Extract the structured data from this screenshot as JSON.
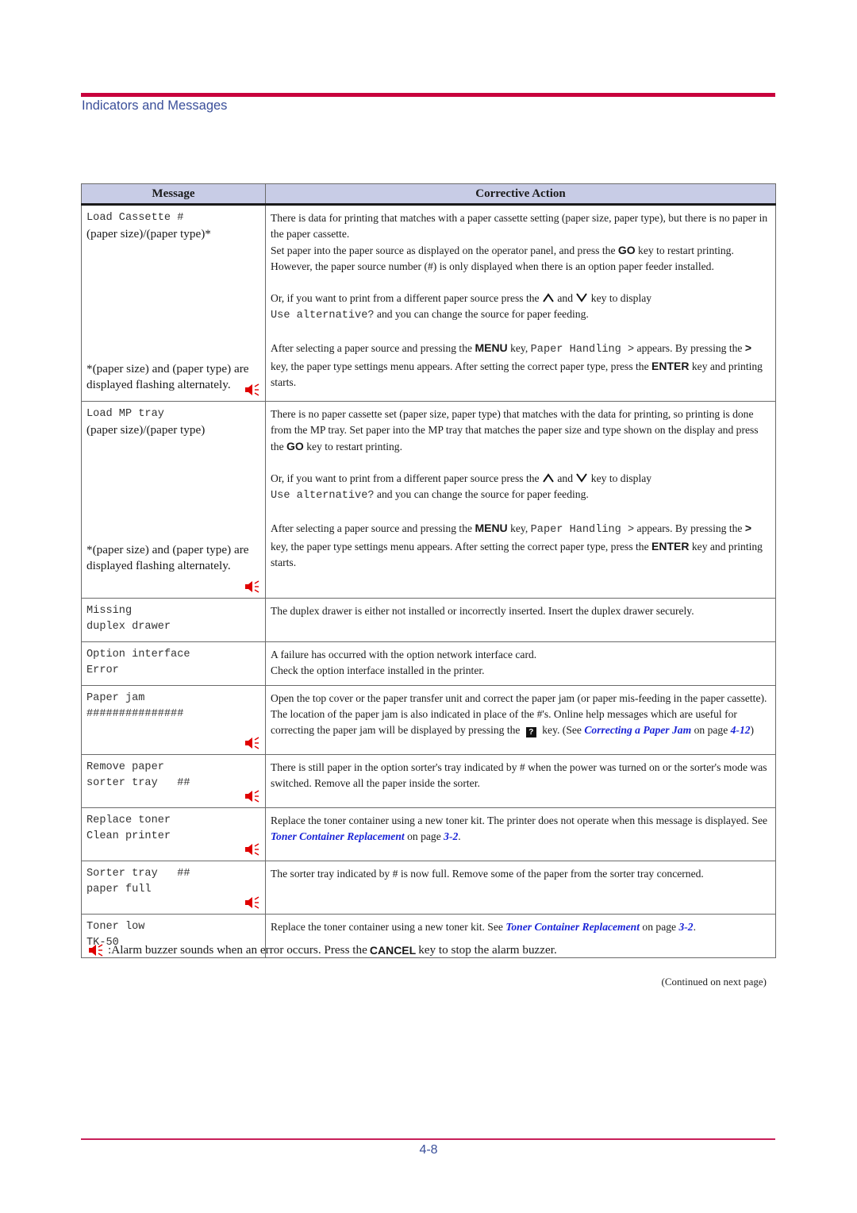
{
  "header": {
    "section_title": "Indicators and Messages"
  },
  "table": {
    "columns": [
      "Message",
      "Corrective Action"
    ],
    "rows": [
      {
        "message_lines": [
          "Load Cassette #"
        ],
        "message_serif": "(paper size)/(paper type)*",
        "note": "*(paper size) and (paper type) are displayed flashing alternately.",
        "alarm": true,
        "p1": "There is data for printing that matches with a paper cassette setting (paper size, paper type), but there is no paper in the paper cassette.",
        "p2_pre": "Set paper into the paper source as displayed on the operator panel, and press the ",
        "p2_key": "GO",
        "p2_post": " key to restart printing. However, the paper source number (#) is only displayed when there is an option paper feeder installed.",
        "p3_pre": "Or, if you want to print from a different paper source press the ",
        "p3_and": " and ",
        "p3_post": " key to display ",
        "p3_mono": "Use alternative?",
        "p3_end": " and you can change the source for paper feeding.",
        "p4_pre": "After selecting a paper source and pressing the ",
        "p4_key1": "MENU",
        "p4_mid": " key, ",
        "p4_mono": "Paper Handling >",
        "p4_mid2": " appears. By pressing the ",
        "p4_key2": ">",
        "p4_mid3": " key, the paper type settings menu appears. After setting the correct paper type, press the ",
        "p4_key3": "ENTER",
        "p4_end": " key and printing starts."
      },
      {
        "message_lines": [
          "Load MP tray"
        ],
        "message_serif": "(paper size)/(paper type)",
        "note": "*(paper size) and (paper type) are displayed flashing alternately.",
        "alarm": true,
        "p1_pre": "There is no paper cassette set (paper size, paper type) that matches with the data for printing, so printing is done from the MP tray. Set paper into the MP tray that matches the paper size and type shown on the display and press the ",
        "p1_key": "GO",
        "p1_post": " key to restart printing.",
        "p3_pre": "Or, if you want to print from a different paper source press the ",
        "p3_and": " and ",
        "p3_post": " key to display ",
        "p3_mono": "Use alternative?",
        "p3_end": " and you can change the source for paper feeding.",
        "p4_pre": "After selecting a paper source and pressing the ",
        "p4_key1": "MENU",
        "p4_mid": " key, ",
        "p4_mono": "Paper Handling >",
        "p4_mid2": " appears. By pressing the ",
        "p4_key2": ">",
        "p4_mid3": " key, the paper type settings menu appears. After setting the correct paper type, press the ",
        "p4_key3": "ENTER",
        "p4_end": " key and printing starts."
      },
      {
        "message_lines": [
          "Missing",
          "duplex drawer"
        ],
        "alarm": false,
        "action": "The duplex drawer is either not installed or incorrectly inserted. Insert the duplex drawer securely."
      },
      {
        "message_lines": [
          "Option interface",
          "Error"
        ],
        "alarm": false,
        "action_l1": "A failure has occurred with the option network interface card.",
        "action_l2": "Check the option interface installed in the printer."
      },
      {
        "message_lines": [
          "Paper jam",
          "###############"
        ],
        "alarm": true,
        "action_pre": "Open the top cover or the paper transfer unit and correct the paper jam (or paper mis-feeding in the paper cassette). The location of the paper jam is also indicated in place of the #'s. Online help messages which are useful for correcting the paper jam will be displayed by pressing the ",
        "help_key": "?",
        "action_mid": " key. (See ",
        "link": "Correcting a Paper Jam",
        "action_mid2": " on page ",
        "page_ref": "4-12",
        "action_end": ")"
      },
      {
        "message_lines": [
          "Remove paper",
          "sorter tray   ##"
        ],
        "alarm": true,
        "action": "There is still paper in the option sorter's tray indicated by # when the power was turned on or the sorter's mode was switched. Remove all the paper inside the sorter."
      },
      {
        "message_lines": [
          "Replace toner",
          "Clean printer"
        ],
        "alarm": true,
        "action_pre": "Replace the toner container using a new toner kit. The printer does not operate when this message is displayed. See ",
        "link": "Toner Container Replacement",
        "action_mid": " on page ",
        "page_ref": "3-2",
        "action_end": "."
      },
      {
        "message_lines": [
          "Sorter tray   ##",
          "paper full"
        ],
        "alarm": true,
        "action": "The sorter tray indicated by # is now full. Remove some of the paper from the sorter tray concerned."
      },
      {
        "message_lines": [
          "Toner low",
          "TK-50"
        ],
        "alarm": false,
        "action_pre": "Replace the toner container using a new toner kit. See ",
        "link": "Toner Container Replacement",
        "action_mid": " on page ",
        "page_ref": "3-2",
        "action_end": "."
      }
    ]
  },
  "legend": {
    "icon": "alarm-buzzer-icon",
    "text_pre": ":Alarm buzzer sounds when an error occurs. Press the ",
    "key": "CANCEL",
    "text_post": " key to stop the alarm buzzer."
  },
  "continued": "(Continued on next page)",
  "footer": {
    "page_number": "4-8"
  },
  "colors": {
    "accent_rule": "#c8003c",
    "title_blue": "#3a4f9a",
    "link_blue": "#1a24d6",
    "header_fill": "#c8cce6",
    "alarm_red": "#e00000"
  }
}
